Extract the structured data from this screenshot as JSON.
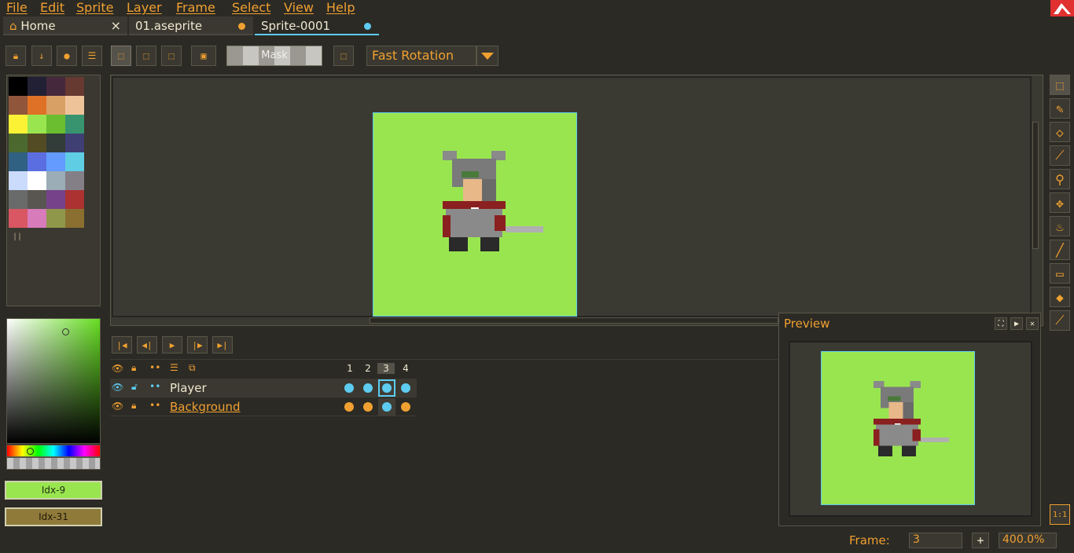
{
  "menu": [
    "File",
    "Edit",
    "Sprite",
    "Layer",
    "Frame",
    "Select",
    "View",
    "Help"
  ],
  "tabs": [
    {
      "label": "Home",
      "close": "×"
    },
    {
      "label": "01.aseprite"
    },
    {
      "label": "Sprite-0001"
    }
  ],
  "toolbar": {
    "mask_label": "Mask",
    "rotation_algorithm": "Fast Rotation"
  },
  "palette": {
    "colors": [
      "#000000",
      "#222034",
      "#45283c",
      "#663931",
      "#8f563b",
      "#df7126",
      "#d9a066",
      "#eec39a",
      "#fbf236",
      "#99e550",
      "#6abe30",
      "#37946e",
      "#4b692f",
      "#524b24",
      "#323c39",
      "#3f3f74",
      "#306082",
      "#5b6ee1",
      "#639bff",
      "#5fcde4",
      "#cbdbfc",
      "#ffffff",
      "#9badb7",
      "#847e87",
      "#696a6a",
      "#595652",
      "#76428a",
      "#ac3232",
      "#d95763",
      "#d77bba",
      "#8f974a",
      "#8a6f30"
    ],
    "handle": "||"
  },
  "colors": {
    "foreground": {
      "label": "Idx-9",
      "hex": "#99e550"
    },
    "background": {
      "label": "Idx-31",
      "hex": "#8f7a3a"
    }
  },
  "timeline": {
    "frames": [
      "1",
      "2",
      "3",
      "4"
    ],
    "current_frame": "3",
    "layers": [
      {
        "name": "Player",
        "cels": [
          "cyan",
          "cyan",
          "cyan",
          "cyan"
        ]
      },
      {
        "name": "Background",
        "cels": [
          "orange",
          "orange",
          "cyan",
          "orange"
        ]
      }
    ]
  },
  "preview": {
    "title": "Preview"
  },
  "status": {
    "frame_label": "Frame:",
    "frame_value": "3",
    "add_frame": "+",
    "zoom": "400.0%",
    "zoom_reset": "1:1"
  },
  "accent": "#f0a030",
  "highlight": "#5ecbf0"
}
